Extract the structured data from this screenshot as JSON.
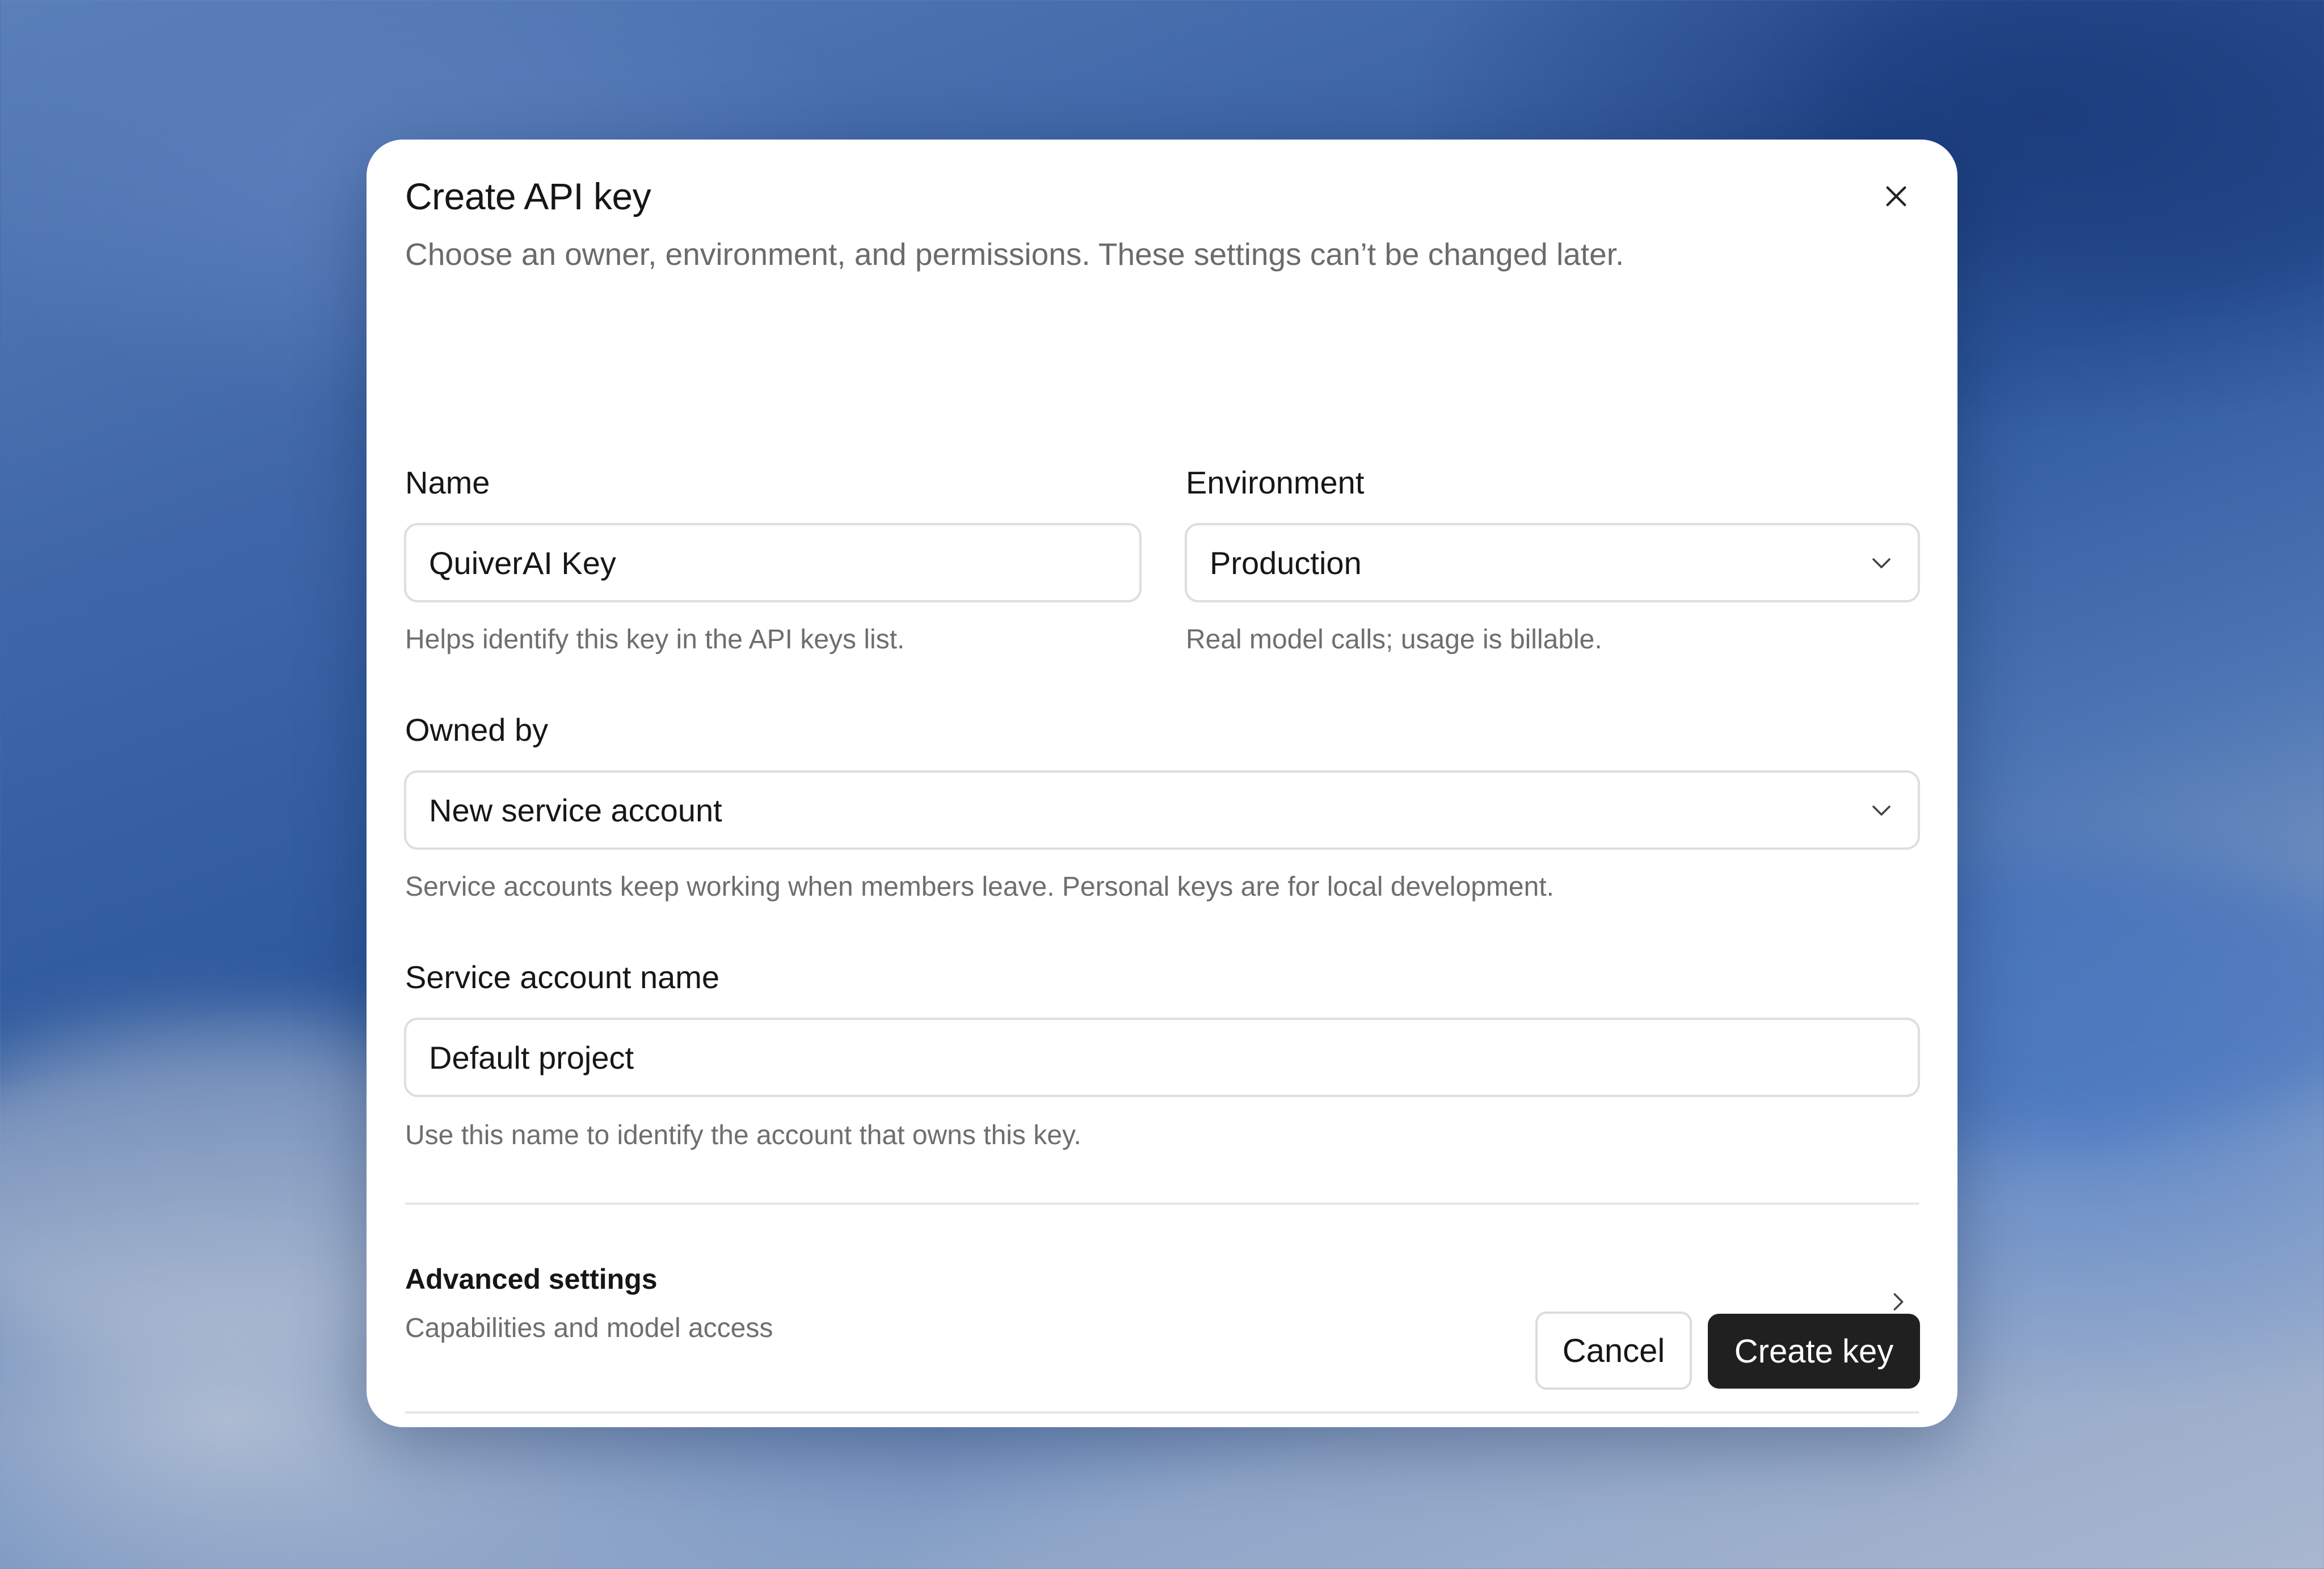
{
  "dialog": {
    "title": "Create API key",
    "subtitle": "Choose an owner, environment, and permissions. These settings can’t be changed later.",
    "close_icon": "close-icon"
  },
  "name": {
    "label": "Name",
    "value": "QuiverAI Key",
    "hint": "Helps identify this key in the API keys list."
  },
  "environment": {
    "label": "Environment",
    "value": "Production",
    "hint": "Real model calls; usage is billable.",
    "icon": "chevron-down-icon"
  },
  "owned_by": {
    "label": "Owned by",
    "value": "New service account",
    "hint": "Service accounts keep working when members leave. Personal keys are for local development.",
    "icon": "chevron-down-icon"
  },
  "service_account": {
    "label": "Service account name",
    "value": "Default project",
    "hint": "Use this name to identify the account that owns this key."
  },
  "advanced": {
    "title": "Advanced settings",
    "subtitle": "Capabilities and model access",
    "icon": "chevron-right-icon"
  },
  "footer": {
    "cancel_label": "Cancel",
    "create_label": "Create key"
  },
  "colors": {
    "primary_button": "#202020",
    "text": "#161616",
    "muted_text": "#6e6e6e",
    "border": "#dedede"
  }
}
